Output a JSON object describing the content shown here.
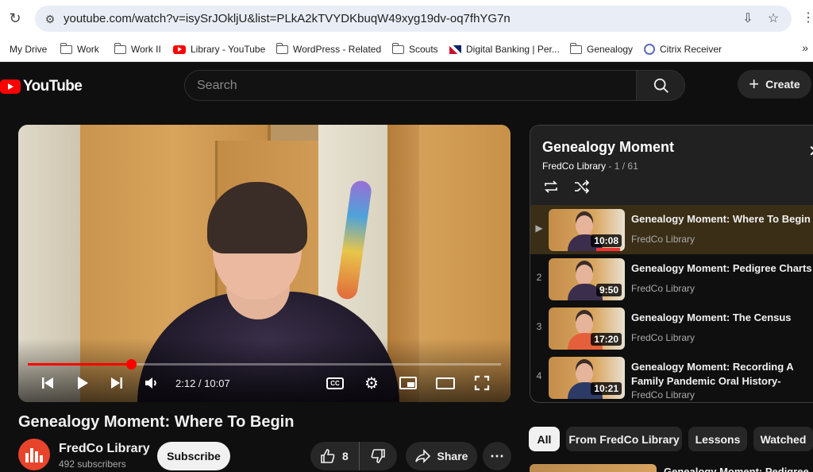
{
  "browser": {
    "url": "youtube.com/watch?v=isySrJOkljU&list=PLkA2kTVYDKbuqW49xyg19dv-oq7fhYG7n",
    "bookmarks": [
      {
        "label": "My Drive",
        "icon": "drive-icon"
      },
      {
        "label": "Work",
        "icon": "folder-icon"
      },
      {
        "label": "Work II",
        "icon": "folder-icon"
      },
      {
        "label": "Library - YouTube",
        "icon": "youtube-icon"
      },
      {
        "label": "WordPress - Related",
        "icon": "folder-icon"
      },
      {
        "label": "Scouts",
        "icon": "folder-icon"
      },
      {
        "label": "Digital Banking | Per...",
        "icon": "flag-icon"
      },
      {
        "label": "Genealogy",
        "icon": "folder-icon"
      },
      {
        "label": "Citrix Receiver",
        "icon": "citrix-icon"
      }
    ]
  },
  "header": {
    "logo_text": "YouTube",
    "search_placeholder": "Search",
    "create_label": "Create"
  },
  "player": {
    "current_time": "2:12",
    "duration": "10:07",
    "time_display": "2:12 / 10:07",
    "progress": 0.218,
    "cc_label": "CC"
  },
  "video": {
    "title": "Genealogy Moment: Where To Begin",
    "channel": "FredCo Library",
    "subscribers": "492 subscribers",
    "subscribe_label": "Subscribe",
    "likes": "8",
    "share_label": "Share"
  },
  "playlist": {
    "title": "Genealogy Moment",
    "channel": "FredCo Library",
    "position": "1 / 61",
    "items": [
      {
        "index": "▶",
        "title": "Genealogy Moment: Where To Begin",
        "channel": "FredCo Library",
        "duration": "10:08",
        "active": true
      },
      {
        "index": "2",
        "title": "Genealogy Moment: Pedigree Charts",
        "channel": "FredCo Library",
        "duration": "9:50",
        "active": false
      },
      {
        "index": "3",
        "title": "Genealogy Moment: The Census",
        "channel": "FredCo Library",
        "duration": "17:20",
        "active": false
      },
      {
        "index": "4",
        "title": "Genealogy Moment: Recording A Family Pandemic Oral History-",
        "channel": "FredCo Library",
        "duration": "10:21",
        "active": false
      }
    ]
  },
  "chips": [
    {
      "label": "All",
      "active": true
    },
    {
      "label": "From FredCo Library",
      "active": false
    },
    {
      "label": "Lessons",
      "active": false
    },
    {
      "label": "Watched",
      "active": false
    }
  ],
  "next_video_peek": "Genealogy Moment: Pedigree",
  "colors": {
    "brand_red": "#ff0000",
    "background": "#0f0f0f",
    "active_row": "#3a2e16"
  }
}
